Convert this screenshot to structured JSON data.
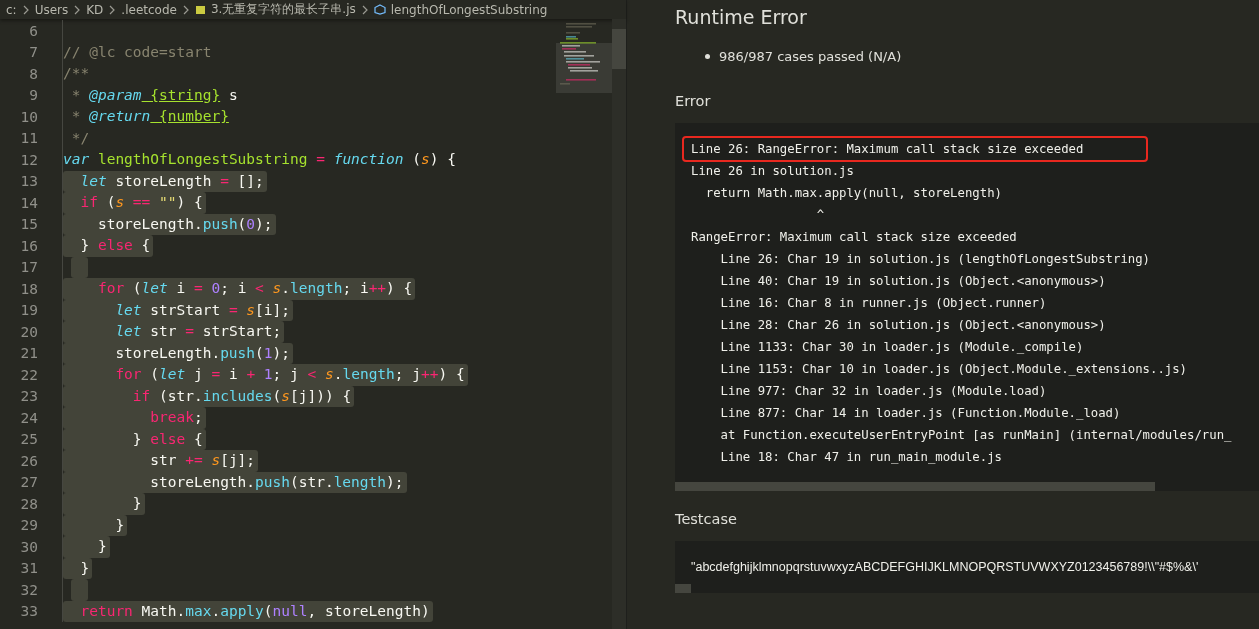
{
  "breadcrumb": [
    {
      "label": "c:"
    },
    {
      "label": "Users"
    },
    {
      "label": "KD"
    },
    {
      "label": ".leetcode"
    },
    {
      "label": "3.无重复字符的最长子串.js",
      "kind": "file"
    },
    {
      "label": "lengthOfLongestSubstring",
      "kind": "symbol"
    }
  ],
  "editor": {
    "lines": [
      {
        "number": "6",
        "selected": false
      },
      {
        "number": "7",
        "selected": false,
        "tokens": [
          {
            "text": "// @lc code=start",
            "kind": "comment"
          }
        ]
      },
      {
        "number": "8",
        "selected": false,
        "tokens": [
          {
            "text": "/**",
            "kind": "comment"
          }
        ]
      },
      {
        "number": "9",
        "selected": false,
        "tokens": [
          {
            "text": " * ",
            "kind": "comment"
          },
          {
            "text": "@param",
            "kind": "doctag"
          },
          {
            "text": " {string}",
            "kind": "doctype"
          },
          {
            "text": " s",
            "kind": "plain"
          }
        ]
      },
      {
        "number": "10",
        "selected": false,
        "tokens": [
          {
            "text": " * ",
            "kind": "comment"
          },
          {
            "text": "@return",
            "kind": "doctag"
          },
          {
            "text": " {number}",
            "kind": "doctype"
          }
        ]
      },
      {
        "number": "11",
        "selected": false,
        "tokens": [
          {
            "text": " */",
            "kind": "comment"
          }
        ]
      },
      {
        "number": "12",
        "selected": false,
        "tokens": [
          {
            "text": "var",
            "kind": "storage"
          },
          {
            "text": " lengthOfLongestSubstring",
            "kind": "entity"
          },
          {
            "text": " = ",
            "kind": "operator"
          },
          {
            "text": "function",
            "kind": "storage"
          },
          {
            "text": " (",
            "kind": "plain"
          },
          {
            "text": "s",
            "kind": "param"
          },
          {
            "text": ") {",
            "kind": "plain"
          }
        ]
      },
      {
        "number": "13",
        "selected": true,
        "tokens": [
          {
            "text": "  let",
            "kind": "storage"
          },
          {
            "text": " storeLength ",
            "kind": "plain"
          },
          {
            "text": "=",
            "kind": "operator"
          },
          {
            "text": " [];",
            "kind": "plain"
          }
        ]
      },
      {
        "number": "14",
        "selected": true,
        "tokens": [
          {
            "text": "  if",
            "kind": "keyword"
          },
          {
            "text": " (",
            "kind": "plain"
          },
          {
            "text": "s",
            "kind": "param"
          },
          {
            "text": " == ",
            "kind": "operator"
          },
          {
            "text": "\"\"",
            "kind": "string"
          },
          {
            "text": ") {",
            "kind": "plain"
          }
        ]
      },
      {
        "number": "15",
        "selected": true,
        "tokens": [
          {
            "text": "    storeLength.",
            "kind": "plain"
          },
          {
            "text": "push",
            "kind": "support"
          },
          {
            "text": "(",
            "kind": "plain"
          },
          {
            "text": "0",
            "kind": "number"
          },
          {
            "text": ");",
            "kind": "plain"
          }
        ]
      },
      {
        "number": "16",
        "selected": true,
        "tokens": [
          {
            "text": "  } ",
            "kind": "plain"
          },
          {
            "text": "else",
            "kind": "keyword"
          },
          {
            "text": " {",
            "kind": "plain"
          }
        ]
      },
      {
        "number": "17",
        "selected": true
      },
      {
        "number": "18",
        "selected": true,
        "tokens": [
          {
            "text": "    for",
            "kind": "keyword"
          },
          {
            "text": " (",
            "kind": "plain"
          },
          {
            "text": "let",
            "kind": "storage"
          },
          {
            "text": " i ",
            "kind": "plain"
          },
          {
            "text": "= ",
            "kind": "operator"
          },
          {
            "text": "0",
            "kind": "number"
          },
          {
            "text": "; i ",
            "kind": "plain"
          },
          {
            "text": "< ",
            "kind": "operator"
          },
          {
            "text": "s",
            "kind": "param"
          },
          {
            "text": ".",
            "kind": "plain"
          },
          {
            "text": "length",
            "kind": "support"
          },
          {
            "text": "; i",
            "kind": "plain"
          },
          {
            "text": "++",
            "kind": "operator"
          },
          {
            "text": ") {",
            "kind": "plain"
          }
        ]
      },
      {
        "number": "19",
        "selected": true,
        "tokens": [
          {
            "text": "      let",
            "kind": "storage"
          },
          {
            "text": " strStart ",
            "kind": "plain"
          },
          {
            "text": "= ",
            "kind": "operator"
          },
          {
            "text": "s",
            "kind": "param"
          },
          {
            "text": "[i];",
            "kind": "plain"
          }
        ]
      },
      {
        "number": "20",
        "selected": true,
        "tokens": [
          {
            "text": "      let",
            "kind": "storage"
          },
          {
            "text": " str ",
            "kind": "plain"
          },
          {
            "text": "=",
            "kind": "operator"
          },
          {
            "text": " strStart;",
            "kind": "plain"
          }
        ]
      },
      {
        "number": "21",
        "selected": true,
        "tokens": [
          {
            "text": "      storeLength.",
            "kind": "plain"
          },
          {
            "text": "push",
            "kind": "support"
          },
          {
            "text": "(",
            "kind": "plain"
          },
          {
            "text": "1",
            "kind": "number"
          },
          {
            "text": ");",
            "kind": "plain"
          }
        ]
      },
      {
        "number": "22",
        "selected": true,
        "tokens": [
          {
            "text": "      for",
            "kind": "keyword"
          },
          {
            "text": " (",
            "kind": "plain"
          },
          {
            "text": "let",
            "kind": "storage"
          },
          {
            "text": " j ",
            "kind": "plain"
          },
          {
            "text": "=",
            "kind": "operator"
          },
          {
            "text": " i ",
            "kind": "plain"
          },
          {
            "text": "+ ",
            "kind": "operator"
          },
          {
            "text": "1",
            "kind": "number"
          },
          {
            "text": "; j ",
            "kind": "plain"
          },
          {
            "text": "< ",
            "kind": "operator"
          },
          {
            "text": "s",
            "kind": "param"
          },
          {
            "text": ".",
            "kind": "plain"
          },
          {
            "text": "length",
            "kind": "support"
          },
          {
            "text": "; j",
            "kind": "plain"
          },
          {
            "text": "++",
            "kind": "operator"
          },
          {
            "text": ") {",
            "kind": "plain"
          }
        ]
      },
      {
        "number": "23",
        "selected": true,
        "tokens": [
          {
            "text": "        if",
            "kind": "keyword"
          },
          {
            "text": " (str.",
            "kind": "plain"
          },
          {
            "text": "includes",
            "kind": "support"
          },
          {
            "text": "(",
            "kind": "plain"
          },
          {
            "text": "s",
            "kind": "param"
          },
          {
            "text": "[j])) {",
            "kind": "plain"
          }
        ]
      },
      {
        "number": "24",
        "selected": true,
        "tokens": [
          {
            "text": "          break",
            "kind": "keyword"
          },
          {
            "text": ";",
            "kind": "plain"
          }
        ]
      },
      {
        "number": "25",
        "selected": true,
        "tokens": [
          {
            "text": "        } ",
            "kind": "plain"
          },
          {
            "text": "else",
            "kind": "keyword"
          },
          {
            "text": " {",
            "kind": "plain"
          }
        ]
      },
      {
        "number": "26",
        "selected": true,
        "tokens": [
          {
            "text": "          str ",
            "kind": "plain"
          },
          {
            "text": "+= ",
            "kind": "operator"
          },
          {
            "text": "s",
            "kind": "param"
          },
          {
            "text": "[j];",
            "kind": "plain"
          }
        ]
      },
      {
        "number": "27",
        "selected": true,
        "tokens": [
          {
            "text": "          storeLength.",
            "kind": "plain"
          },
          {
            "text": "push",
            "kind": "support"
          },
          {
            "text": "(str.",
            "kind": "plain"
          },
          {
            "text": "length",
            "kind": "support"
          },
          {
            "text": ");",
            "kind": "plain"
          }
        ]
      },
      {
        "number": "28",
        "selected": true,
        "tokens": [
          {
            "text": "        }",
            "kind": "plain"
          }
        ]
      },
      {
        "number": "29",
        "selected": true,
        "tokens": [
          {
            "text": "      }",
            "kind": "plain"
          }
        ]
      },
      {
        "number": "30",
        "selected": true,
        "tokens": [
          {
            "text": "    }",
            "kind": "plain"
          }
        ]
      },
      {
        "number": "31",
        "selected": true,
        "tokens": [
          {
            "text": "  }",
            "kind": "plain"
          }
        ]
      },
      {
        "number": "32",
        "selected": true
      },
      {
        "number": "33",
        "selected": true,
        "tokens": [
          {
            "text": "  return",
            "kind": "keyword"
          },
          {
            "text": " Math.",
            "kind": "plain"
          },
          {
            "text": "max",
            "kind": "support"
          },
          {
            "text": ".",
            "kind": "plain"
          },
          {
            "text": "apply",
            "kind": "support"
          },
          {
            "text": "(",
            "kind": "plain"
          },
          {
            "text": "null",
            "kind": "number"
          },
          {
            "text": ", storeLength)",
            "kind": "plain"
          }
        ]
      }
    ]
  },
  "result": {
    "title": "Runtime Error",
    "summary": [
      "986/987 cases passed (N/A)"
    ],
    "error": {
      "heading": "Error",
      "lines": [
        {
          "text": "Line 26: RangeError: Maximum call stack size exceeded",
          "highlighted": true
        },
        {
          "text": "Line 26 in solution.js",
          "highlighted": false
        },
        {
          "text": "  return Math.max.apply(null, storeLength)",
          "highlighted": false
        },
        {
          "text": "                 ^",
          "highlighted": false
        },
        {
          "text": "RangeError: Maximum call stack size exceeded",
          "highlighted": false
        },
        {
          "text": "    Line 26: Char 19 in solution.js (lengthOfLongestSubstring)",
          "highlighted": false
        },
        {
          "text": "    Line 40: Char 19 in solution.js (Object.<anonymous>)",
          "highlighted": false
        },
        {
          "text": "    Line 16: Char 8 in runner.js (Object.runner)",
          "highlighted": false
        },
        {
          "text": "    Line 28: Char 26 in solution.js (Object.<anonymous>)",
          "highlighted": false
        },
        {
          "text": "    Line 1133: Char 30 in loader.js (Module._compile)",
          "highlighted": false
        },
        {
          "text": "    Line 1153: Char 10 in loader.js (Object.Module._extensions..js)",
          "highlighted": false
        },
        {
          "text": "    Line 977: Char 32 in loader.js (Module.load)",
          "highlighted": false
        },
        {
          "text": "    Line 877: Char 14 in loader.js (Function.Module._load)",
          "highlighted": false
        },
        {
          "text": "    at Function.executeUserEntryPoint [as runMain] (internal/modules/run_",
          "highlighted": false
        },
        {
          "text": "    Line 18: Char 47 in run_main_module.js",
          "highlighted": false
        }
      ]
    },
    "testcase": {
      "heading": "Testcase",
      "value": "\"abcdefghijklmnopqrstuvwxyzABCDEFGHIJKLMNOPQRSTUVWXYZ0123456789!\\\\\"#$%&\\'"
    }
  }
}
